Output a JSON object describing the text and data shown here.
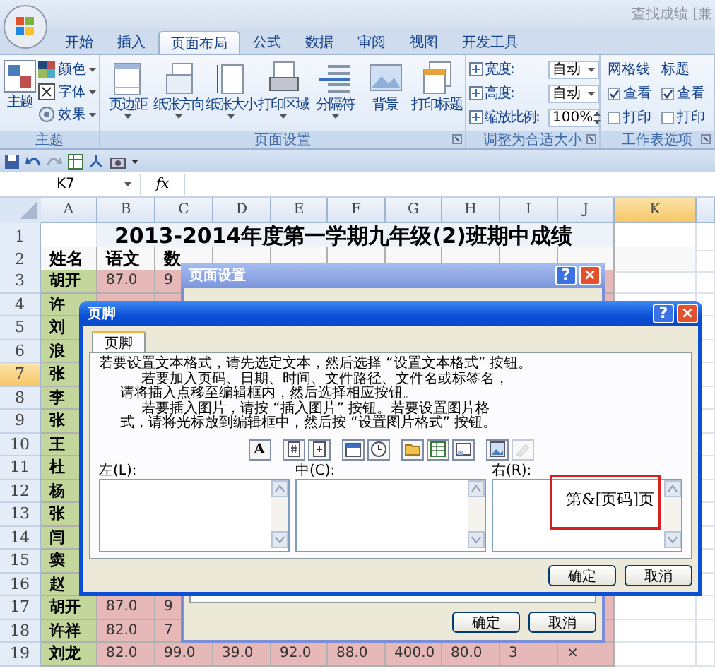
{
  "title_bar": {
    "title": "查找成绩 [兼"
  },
  "ribbon_tabs": [
    {
      "label": "开始",
      "selected": false
    },
    {
      "label": "插入",
      "selected": false
    },
    {
      "label": "页面布局",
      "selected": true
    },
    {
      "label": "公式",
      "selected": false
    },
    {
      "label": "数据",
      "selected": false
    },
    {
      "label": "审阅",
      "selected": false
    },
    {
      "label": "视图",
      "selected": false
    },
    {
      "label": "开发工具",
      "selected": false
    }
  ],
  "ribbon_groups": [
    {
      "kind": "theme",
      "label": "主题",
      "launcher": false,
      "big_button": "主题",
      "small_buttons": [
        "颜色",
        "字体",
        "效果"
      ]
    },
    {
      "kind": "large_buttons",
      "label": "页面设置",
      "launcher": true,
      "buttons": [
        "页边距",
        "纸张方向",
        "纸张大小",
        "打印区域",
        "分隔符",
        "背景",
        "打印标题"
      ]
    },
    {
      "kind": "scale",
      "label": "调整为合适大小",
      "launcher": true,
      "fields": [
        {
          "label": "宽度:",
          "value": "自动"
        },
        {
          "label": "高度:",
          "value": "自动"
        },
        {
          "label": "缩放比例:",
          "value": "100%"
        }
      ]
    },
    {
      "kind": "sheet_options",
      "label": "工作表选项",
      "launcher": true,
      "columns": [
        {
          "heading": "网格线",
          "options": [
            {
              "label": "查看",
              "checked": true
            },
            {
              "label": "打印",
              "checked": false
            }
          ]
        },
        {
          "heading": "标题",
          "options": [
            {
              "label": "查看",
              "checked": true
            },
            {
              "label": "打印",
              "checked": false
            }
          ]
        }
      ]
    }
  ],
  "formula_bar": {
    "name_box": "K7",
    "function_label": "fx"
  },
  "sheet": {
    "columns": [
      {
        "label": "A",
        "selected": false
      },
      {
        "label": "B",
        "selected": false
      },
      {
        "label": "C",
        "selected": false
      },
      {
        "label": "D",
        "selected": false
      },
      {
        "label": "E",
        "selected": false
      },
      {
        "label": "F",
        "selected": false
      },
      {
        "label": "G",
        "selected": false
      },
      {
        "label": "H",
        "selected": false
      },
      {
        "label": "I",
        "selected": false
      },
      {
        "label": "J",
        "selected": false
      },
      {
        "label": "K",
        "selected": true
      }
    ],
    "rows": [
      {
        "number": "1",
        "kind": "title",
        "selected": false,
        "cells": [
          "",
          "2013-2014年度第一学期九年级(2)班期中成绩"
        ]
      },
      {
        "number": "2",
        "kind": "header",
        "selected": false,
        "cells": [
          "姓名",
          "语文",
          "数"
        ]
      },
      {
        "number": "3",
        "kind": "data",
        "selected": false,
        "cells": [
          "胡开",
          "87.0",
          "9"
        ]
      },
      {
        "number": "4",
        "kind": "data",
        "selected": false,
        "cells": [
          "许"
        ]
      },
      {
        "number": "5",
        "kind": "data",
        "selected": false,
        "cells": [
          "刘"
        ]
      },
      {
        "number": "6",
        "kind": "data",
        "selected": false,
        "cells": [
          "浪"
        ]
      },
      {
        "number": "7",
        "kind": "data",
        "selected": true,
        "cells": [
          "张"
        ]
      },
      {
        "number": "8",
        "kind": "data",
        "selected": false,
        "cells": [
          "李"
        ]
      },
      {
        "number": "9",
        "kind": "data",
        "selected": false,
        "cells": [
          "张"
        ]
      },
      {
        "number": "10",
        "kind": "data",
        "selected": false,
        "cells": [
          "王"
        ]
      },
      {
        "number": "11",
        "kind": "data",
        "selected": false,
        "cells": [
          "杜"
        ]
      },
      {
        "number": "12",
        "kind": "data",
        "selected": false,
        "cells": [
          "杨"
        ]
      },
      {
        "number": "13",
        "kind": "data",
        "selected": false,
        "cells": [
          "张"
        ]
      },
      {
        "number": "14",
        "kind": "data",
        "selected": false,
        "cells": [
          "闫"
        ]
      },
      {
        "number": "15",
        "kind": "data",
        "selected": false,
        "cells": [
          "窦"
        ]
      },
      {
        "number": "16",
        "kind": "data",
        "selected": false,
        "cells": [
          "赵"
        ]
      },
      {
        "number": "17",
        "kind": "data",
        "selected": false,
        "cells": [
          "胡开",
          "87.0",
          "9"
        ]
      },
      {
        "number": "18",
        "kind": "data",
        "selected": false,
        "cells": [
          "许祥",
          "82.0",
          "7"
        ]
      },
      {
        "number": "19",
        "kind": "data",
        "selected": false,
        "cells": [
          "刘龙",
          "82.0",
          "99.0",
          "39.0",
          "92.0",
          "88.0",
          "400.0",
          "80.0",
          "3",
          "×"
        ]
      }
    ]
  },
  "page_setup_dialog": {
    "title": "页面设置",
    "title_buttons": [
      "?",
      "×"
    ],
    "buttons": [
      "确定",
      "取消"
    ]
  },
  "footer_dialog": {
    "title": "页脚",
    "title_buttons": [
      "?",
      "×"
    ],
    "tabs": [
      {
        "label": "页脚",
        "selected": true
      }
    ],
    "instructions": [
      {
        "kind": "plain",
        "text": "若要设置文本格式，请先选定文本，然后选择 “设置文本格式” 按钮。"
      },
      {
        "kind": "indented",
        "text": "若要加入页码、日期、时间、文件路径、文件名或标签名，"
      },
      {
        "kind": "continued",
        "text": "请将插入点移至编辑框内，然后选择相应按钮。"
      },
      {
        "kind": "indented",
        "text": "若要插入图片，请按 “插入图片” 按钮。若要设置图片格"
      },
      {
        "kind": "continued",
        "text": "式，请将光标放到编辑框中，然后按 “设置图片格式” 按钮。"
      }
    ],
    "toolbar_groups": [
      [
        {
          "kind": "text_format",
          "label": "A",
          "disabled": false
        }
      ],
      [
        {
          "kind": "page_number",
          "disabled": false
        },
        {
          "kind": "page_count",
          "disabled": false
        }
      ],
      [
        {
          "kind": "date",
          "disabled": false
        },
        {
          "kind": "time",
          "disabled": false
        }
      ],
      [
        {
          "kind": "file_path",
          "disabled": false
        },
        {
          "kind": "file_name",
          "disabled": false
        },
        {
          "kind": "sheet_name",
          "disabled": false
        }
      ],
      [
        {
          "kind": "picture",
          "disabled": false
        },
        {
          "kind": "format_picture",
          "disabled": true
        }
      ]
    ],
    "sections": [
      {
        "label": "左(L):",
        "highlighted": false
      },
      {
        "label": "中(C):",
        "highlighted": false
      },
      {
        "label": "右(R):",
        "text": "第&[页码]页",
        "highlighted": true
      }
    ],
    "buttons": [
      "确定",
      "取消"
    ]
  }
}
